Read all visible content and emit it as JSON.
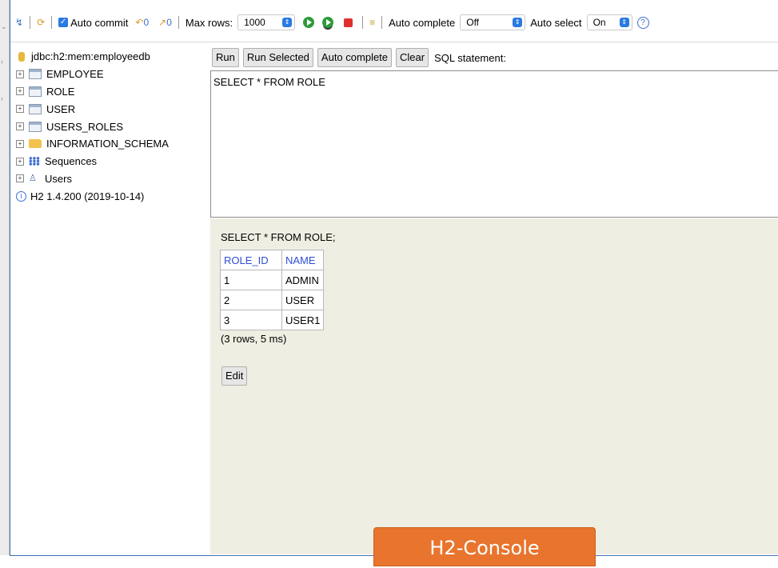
{
  "toolbar": {
    "auto_commit_label": "Auto commit",
    "max_rows_label": "Max rows:",
    "max_rows_value": "1000",
    "auto_complete_label": "Auto complete",
    "auto_complete_value": "Off",
    "auto_select_label": "Auto select",
    "auto_select_value": "On"
  },
  "tree": {
    "connection": "jdbc:h2:mem:employeedb",
    "items": [
      {
        "label": "EMPLOYEE",
        "icon": "table-icon"
      },
      {
        "label": "ROLE",
        "icon": "table-icon"
      },
      {
        "label": "USER",
        "icon": "table-icon"
      },
      {
        "label": "USERS_ROLES",
        "icon": "table-icon"
      },
      {
        "label": "INFORMATION_SCHEMA",
        "icon": "folder-icon"
      },
      {
        "label": "Sequences",
        "icon": "sequences-icon"
      },
      {
        "label": "Users",
        "icon": "users-icon"
      }
    ],
    "version": "H2 1.4.200 (2019-10-14)"
  },
  "sql_bar": {
    "run_label": "Run",
    "run_selected_label": "Run Selected",
    "auto_complete_label": "Auto complete",
    "clear_label": "Clear",
    "statement_label": "SQL statement:"
  },
  "editor": {
    "text": "SELECT * FROM ROLE"
  },
  "results": {
    "query": "SELECT * FROM ROLE;",
    "columns": [
      "ROLE_ID",
      "NAME"
    ],
    "rows": [
      [
        "1",
        "ADMIN"
      ],
      [
        "2",
        "USER"
      ],
      [
        "3",
        "USER1"
      ]
    ],
    "summary": "(3 rows, 5 ms)",
    "edit_label": "Edit"
  },
  "caption": "H2-Console",
  "colors": {
    "accent": "#2a7ae2",
    "caption_bg": "#e8742e",
    "results_bg": "#efeee2",
    "header_text": "#2f4fd6"
  }
}
